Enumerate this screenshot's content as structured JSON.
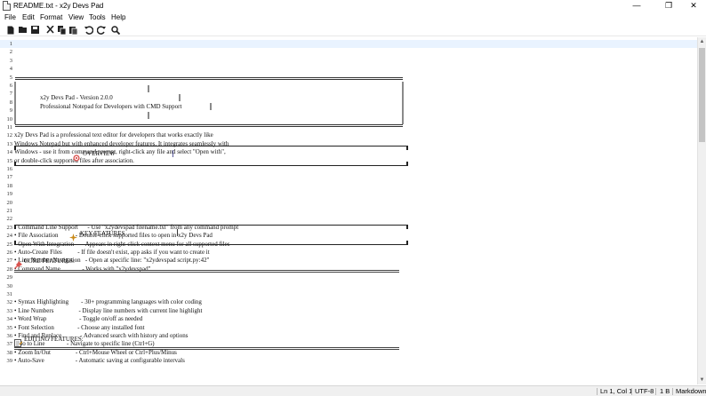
{
  "window": {
    "title": "README.txt - x2y Devs Pad",
    "minimize": "—",
    "maximize": "❐",
    "close": "✕"
  },
  "menu": [
    "File",
    "Edit",
    "Format",
    "View",
    "Tools",
    "Help"
  ],
  "toolbar": {
    "buttons": [
      "new-file",
      "open-file",
      "save",
      "cut",
      "copy",
      "paste",
      "undo",
      "redo",
      "find"
    ]
  },
  "editor": {
    "lines": [
      {
        "n": "1",
        "t": ""
      },
      {
        "n": "2",
        "t": ""
      },
      {
        "n": "3",
        "t": ""
      },
      {
        "n": "4",
        "t": ""
      },
      {
        "n": "5",
        "t": ""
      },
      {
        "n": "6",
        "t": ""
      },
      {
        "n": "7",
        "t": ""
      },
      {
        "n": "8",
        "t": ""
      },
      {
        "n": "9",
        "t": ""
      },
      {
        "n": "10",
        "t": ""
      },
      {
        "n": "11",
        "t": ""
      },
      {
        "n": "12",
        "t": "x2y Devs Pad is a professional text editor for developers that works exactly like"
      },
      {
        "n": "13",
        "t": "Windows Notepad but with enhanced developer features. It integrates seamlessly with"
      },
      {
        "n": "14",
        "t": "Windows - use it from command prompt, right-click any file and select \"Open with\","
      },
      {
        "n": "15",
        "t": "or double-click supported files after association."
      },
      {
        "n": "16",
        "t": ""
      },
      {
        "n": "17",
        "t": ""
      },
      {
        "n": "18",
        "t": ""
      },
      {
        "n": "19",
        "t": ""
      },
      {
        "n": "20",
        "t": ""
      },
      {
        "n": "21",
        "t": ""
      },
      {
        "n": "22",
        "t": ""
      },
      {
        "n": "23",
        "t": "• Command Line Support      - Use \"x2ydevspad filename.txt\" from any command prompt"
      },
      {
        "n": "24",
        "t": "• File Association           - Double-click supported files to open in x2y Devs Pad"
      },
      {
        "n": "25",
        "t": "• Open With Integration     - Appears in right-click context menu for all supported files"
      },
      {
        "n": "26",
        "t": "• Auto-Create Files          - If file doesn't exist, app asks if you want to create it"
      },
      {
        "n": "27",
        "t": "• Line Number Navigation   - Open at specific line: \"x2ydevspad script.py:42\""
      },
      {
        "n": "28",
        "t": "• Command Name              - Works with \"x2ydevspad\""
      },
      {
        "n": "29",
        "t": ""
      },
      {
        "n": "30",
        "t": ""
      },
      {
        "n": "31",
        "t": ""
      },
      {
        "n": "32",
        "t": "• Syntax Highlighting        - 30+ programming languages with color coding"
      },
      {
        "n": "33",
        "t": "• Line Numbers                - Display line numbers with current line highlight"
      },
      {
        "n": "34",
        "t": "• Word Wrap                     - Toggle on/off as needed"
      },
      {
        "n": "35",
        "t": "• Font Selection               - Choose any installed font"
      },
      {
        "n": "36",
        "t": "• Find and Replace            - Advanced search with history and options"
      },
      {
        "n": "37",
        "t": "• Go to Line              - Navigate to specific line (Ctrl+G)"
      },
      {
        "n": "38",
        "t": "• Zoom In/Out                - Ctrl+Mouse Wheel or Ctrl+Plus/Minus"
      },
      {
        "n": "39",
        "t": "• Auto-Save                    - Automatic saving at configurable intervals"
      }
    ],
    "banner": {
      "line1": "x2y Devs Pad - Version 2.0.0",
      "line2": "Professional Notepad for Developers with CMD Support"
    },
    "overview_heading": "OVERVIEW",
    "key_features_heading": "KEY FEATURES",
    "core_features_heading": "CORE FEATURES:",
    "editing_features_heading": "EDITING FEATURES:"
  },
  "status": {
    "position": "Ln 1, Col 1",
    "encoding": "UTF-8",
    "size": "1 B",
    "mode": "Markdown"
  },
  "colors": {
    "current_line": "#e9f3ff",
    "accent_red": "#d9534f",
    "scroll_thumb": "#c4c4c4"
  }
}
